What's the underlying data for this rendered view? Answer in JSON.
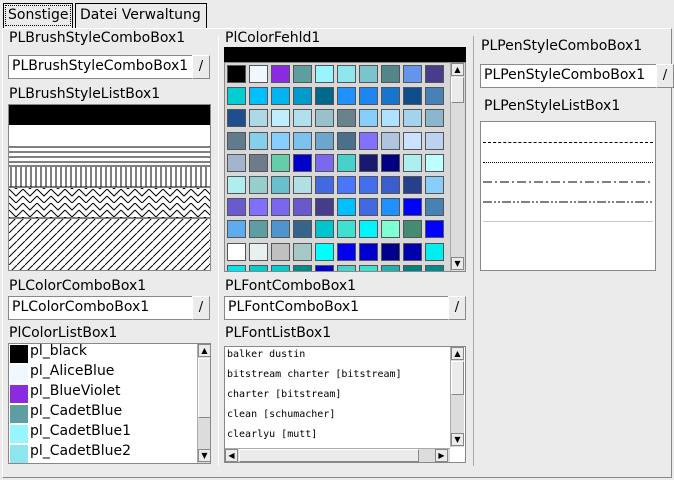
{
  "tabs": [
    {
      "label": "Sonstige",
      "active": true
    },
    {
      "label": "Datei Verwaltung",
      "active": false
    }
  ],
  "brush": {
    "combo_label": "PLBrushStyleComboBox1",
    "combo_value": "PLBrushStyleComboBox1",
    "list_label": "PLBrushStyleListBox1"
  },
  "color_grid": {
    "label": "PlColorFehld1",
    "swatches": [
      "#000000",
      "#f0f8ff",
      "#8a2be2",
      "#5f9ea0",
      "#98f5ff",
      "#8ee5ee",
      "#7ac5cd",
      "#53868b",
      "#6495ed",
      "#483d8b",
      "#00ced1",
      "#00bfff",
      "#00b2ee",
      "#009acd",
      "#00688b",
      "#1e90ff",
      "#1c86ee",
      "#1874cd",
      "#104e8b",
      "#4682b4",
      "#1e4e8b",
      "#add8e6",
      "#bfefff",
      "#b2dfee",
      "#9ac0cd",
      "#68838b",
      "#87cefa",
      "#b0e2ff",
      "#a4d3ee",
      "#8db6cd",
      "#607b8b",
      "#87ceeb",
      "#87ceff",
      "#7ec0ee",
      "#6ca6cd",
      "#4a708b",
      "#8470ff",
      "#b0c4de",
      "#cae1ff",
      "#bcd2ee",
      "#a2b5cd",
      "#6e7b8b",
      "#66cdaa",
      "#0000cd",
      "#7b68ee",
      "#48d1cc",
      "#191970",
      "#000080",
      "#afeeee",
      "#bbffff",
      "#aeeeee",
      "#96cdcd",
      "#66c0cd",
      "#b0e0e6",
      "#4169e1",
      "#4876ff",
      "#436eee",
      "#3a5fcd",
      "#27408b",
      "#87cefa",
      "#6a5acd",
      "#836fff",
      "#7a67ee",
      "#6959cd",
      "#473c8b",
      "#00bfff",
      "#4169e1",
      "#1e90ff",
      "#0000ff",
      "#4682b4",
      "#5cacee",
      "#5f9ea0",
      "#4f94cd",
      "#36648b",
      "#00c5cd",
      "#40e0d0",
      "#00f5ff",
      "#7fffd4",
      "#458b74",
      "#0000ff",
      "#ffffff",
      "#e8f0f0",
      "#c0c0c0",
      "#a8c8c8",
      "#00ffff",
      "#0000ee",
      "#0000cd",
      "#00008b",
      "#0000aa",
      "#00eeee",
      "#00e5ee",
      "#00cdcd",
      "#00cdcd",
      "#008b8b",
      "#0000cd",
      "#48d1cc",
      "#40e0d0",
      "#20b2aa",
      "#008080",
      "#008b8b"
    ]
  },
  "pen": {
    "combo_label": "PLPenStyleComboBox1",
    "combo_value": "PLPenStyleComboBox1",
    "list_label": "PLPenStyleListBox1"
  },
  "color_combo": {
    "label": "PLColorComboBox1",
    "value": "PLColorComboBox1"
  },
  "font_combo": {
    "label": "PLFontComboBox1",
    "value": "PLFontComboBox1"
  },
  "color_list": {
    "label": "PlColorListBox1",
    "items": [
      {
        "name": "pl_black",
        "color": "#000000"
      },
      {
        "name": "pl_AliceBlue",
        "color": "#f0f8ff"
      },
      {
        "name": "pl_BlueViolet",
        "color": "#8a2be2"
      },
      {
        "name": "pl_CadetBlue",
        "color": "#5f9ea0"
      },
      {
        "name": "pl_CadetBlue1",
        "color": "#98f5ff"
      },
      {
        "name": "pl_CadetBlue2",
        "color": "#8ee5ee"
      }
    ]
  },
  "font_list": {
    "label": "PLFontListBox1",
    "items": [
      "balker dustin",
      "bitstream charter [bitstream]",
      "charter [bitstream]",
      "clean [schumacher]",
      "clearlyu [mutt]"
    ]
  },
  "combo_button_glyph": "/",
  "sb_up_glyph": "▲",
  "sb_down_glyph": "▼",
  "sb_left_glyph": "◀",
  "sb_right_glyph": "▶"
}
